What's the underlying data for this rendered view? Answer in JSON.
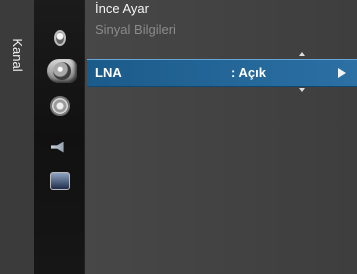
{
  "sidebar": {
    "label": "Kanal"
  },
  "menu": {
    "items": [
      {
        "label": "İnce Ayar",
        "state": "normal"
      },
      {
        "label": "Sinyal Bilgileri",
        "state": "disabled"
      }
    ],
    "selected_option": {
      "label": "LNA",
      "value": ": Açık"
    }
  },
  "icons": [
    "input-icon",
    "channel-icon",
    "setup-icon",
    "sound-icon",
    "picture-icon"
  ],
  "colors": {
    "highlight": "#2c70a4",
    "panel": "#474747",
    "sidebar": "#3b3b3b",
    "disabled_text": "#8b8b8b"
  }
}
